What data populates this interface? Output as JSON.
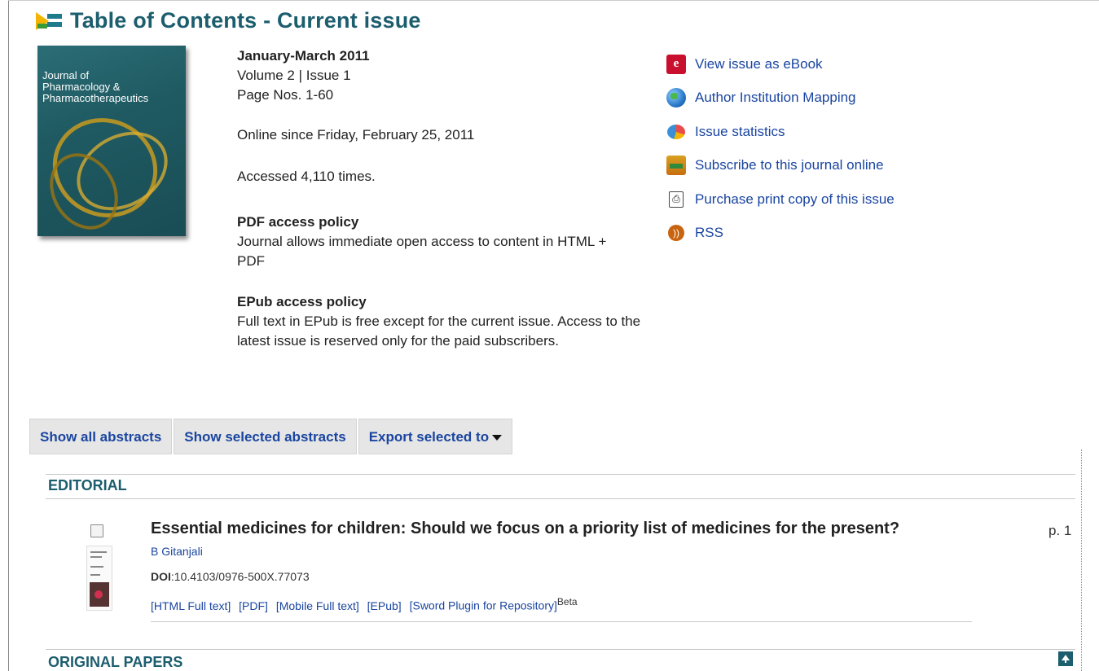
{
  "header": {
    "title": "Table of Contents - Current issue"
  },
  "cover": {
    "journal_title_line1": "Journal of",
    "journal_title_line2": "Pharmacology &",
    "journal_title_line3": "Pharmacotherapeutics"
  },
  "issue": {
    "date": "January-March 2011",
    "volume": "Volume 2 | Issue 1",
    "pages": "Page Nos. 1-60",
    "online_since": "Online since Friday, February 25, 2011",
    "accessed": "Accessed 4,110 times.",
    "pdf_policy_heading": "PDF access policy",
    "pdf_policy_text": "Journal allows immediate open access to content in HTML + PDF",
    "epub_policy_heading": "EPub access policy",
    "epub_policy_text": "Full text in EPub is free except for the current issue. Access to the latest issue is reserved only for the paid subscribers."
  },
  "side_links": [
    {
      "label": "View issue as eBook",
      "icon": "ebook-icon"
    },
    {
      "label": "Author Institution Mapping",
      "icon": "globe-icon"
    },
    {
      "label": "Issue statistics",
      "icon": "pie-chart-icon"
    },
    {
      "label": "Subscribe to this journal online",
      "icon": "subscribe-icon"
    },
    {
      "label": "Purchase print copy of this issue",
      "icon": "print-icon"
    },
    {
      "label": "RSS",
      "icon": "rss-icon"
    }
  ],
  "toolbar": {
    "show_all": "Show all abstracts",
    "show_selected": "Show selected abstracts",
    "export_selected": "Export selected to"
  },
  "sections": [
    {
      "heading": "EDITORIAL",
      "articles": [
        {
          "title": "Essential medicines for children: Should we focus on a priority list of medicines for the present?",
          "page": "p. 1",
          "author": "B Gitanjali",
          "doi_label": "DOI",
          "doi": ":10.4103/0976-500X.77073",
          "links": [
            "[HTML Full text]",
            "[PDF]",
            "[Mobile Full text]",
            "[EPub]",
            "[Sword Plugin for Repository]"
          ],
          "links_sup": "Beta"
        }
      ]
    },
    {
      "heading": "ORIGINAL PAPERS"
    }
  ]
}
